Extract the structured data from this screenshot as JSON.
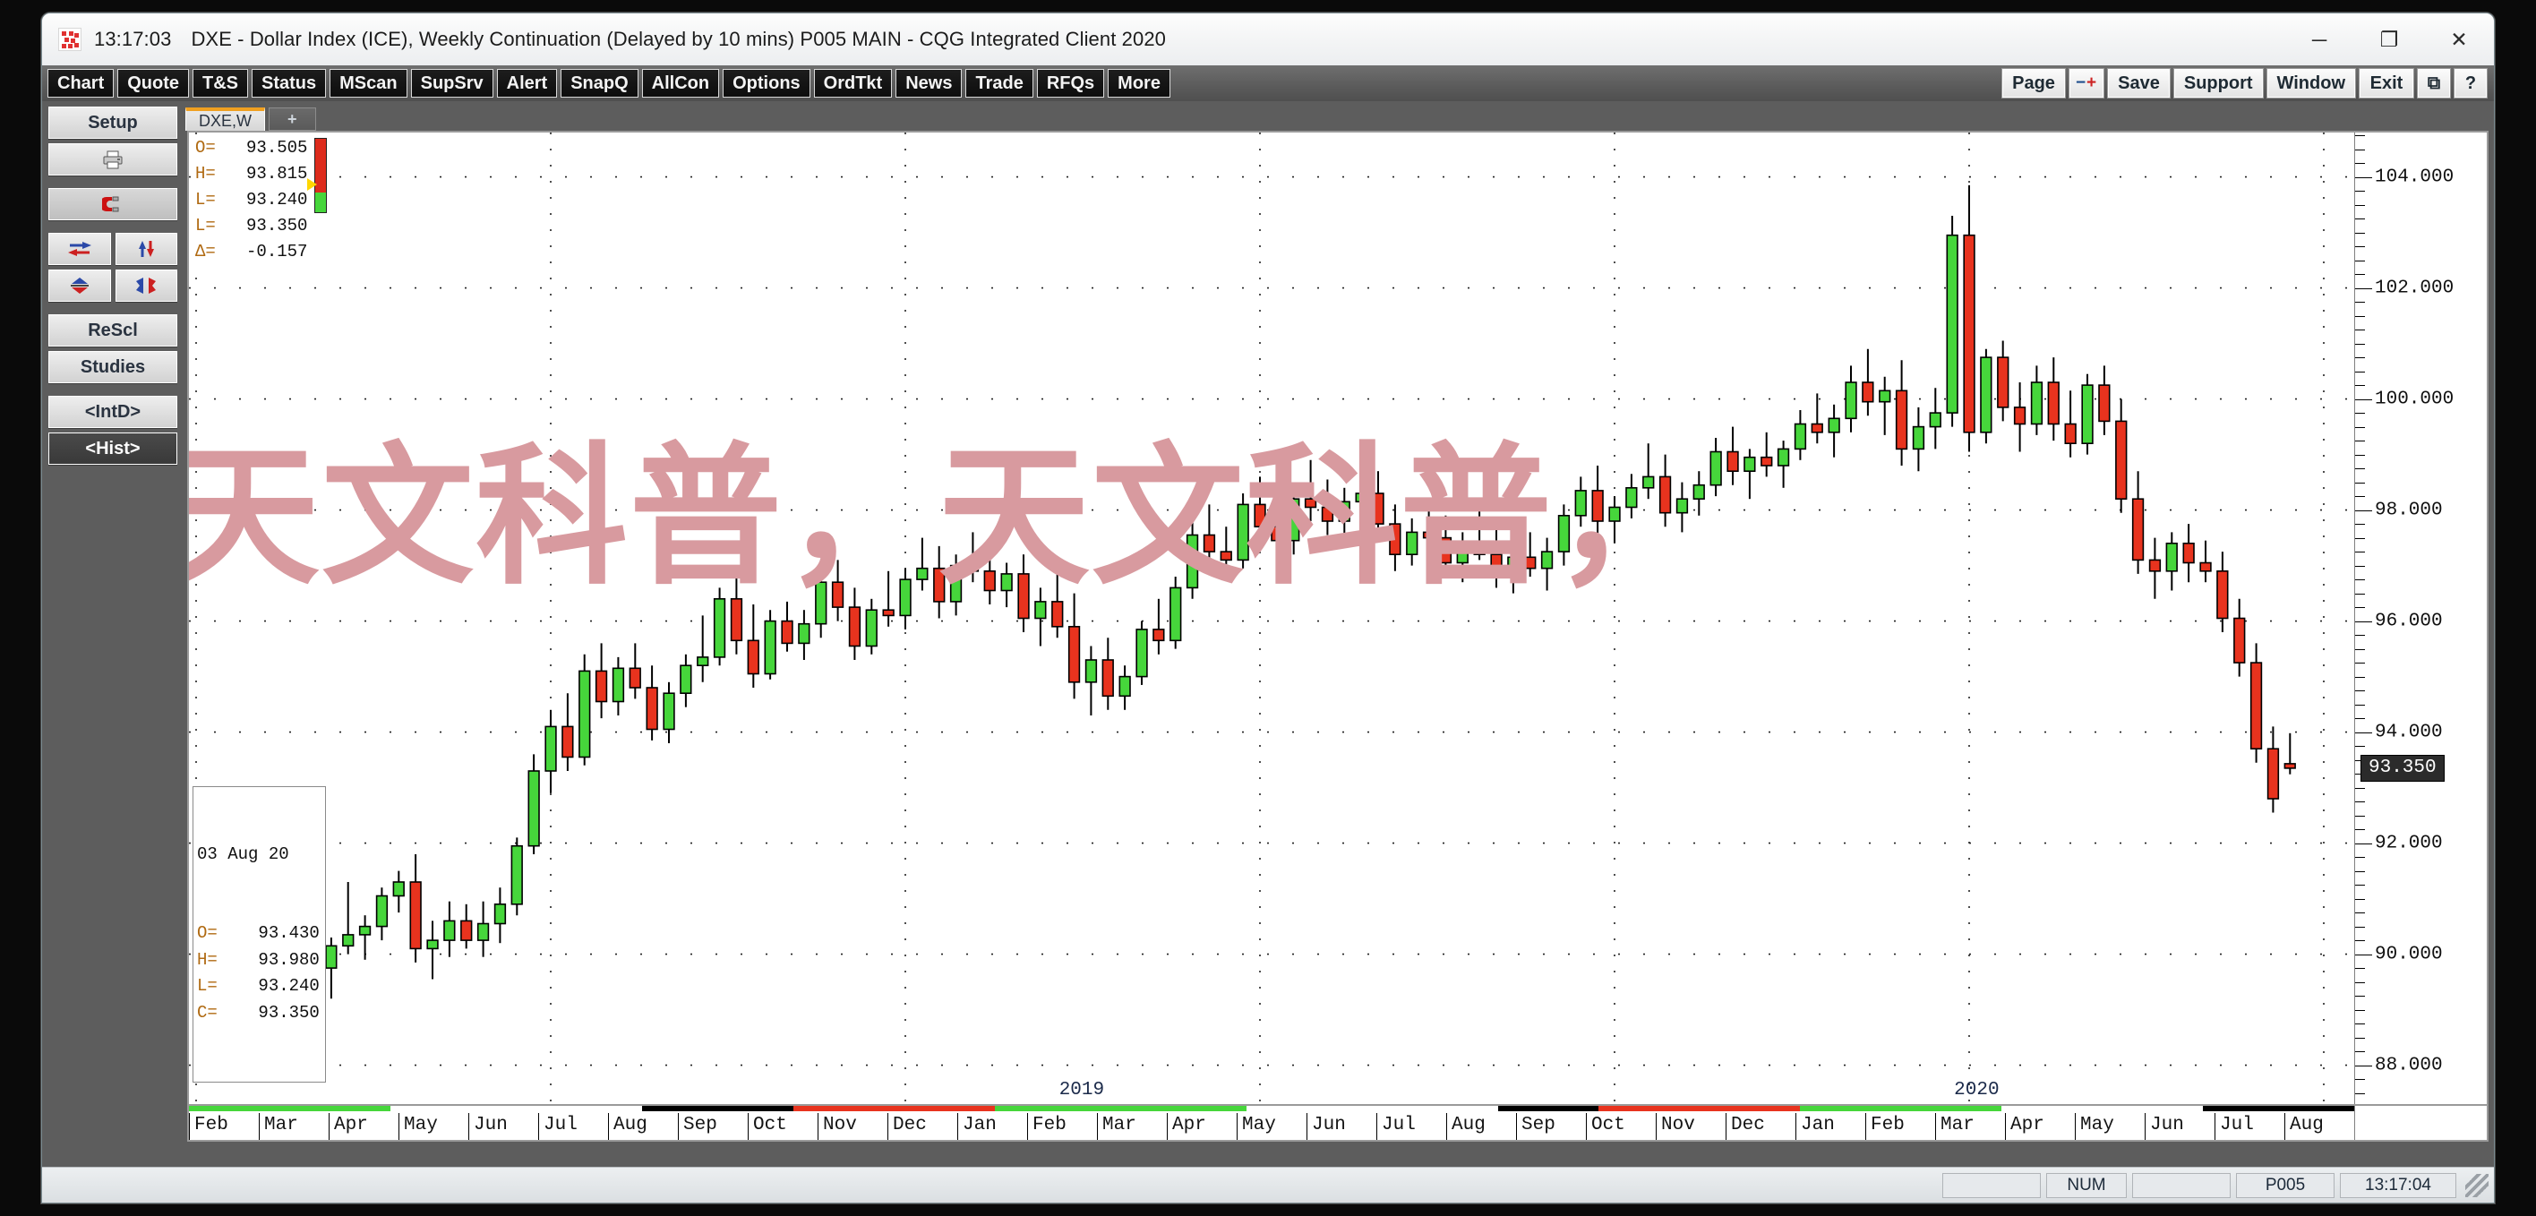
{
  "window": {
    "clock": "13:17:03",
    "title": "DXE - Dollar Index (ICE), Weekly Continuation (Delayed by 10 mins)   P005 MAIN - CQG Integrated Client 2020",
    "minimize": "─",
    "maximize": "❐",
    "close": "✕"
  },
  "toolbar": {
    "left": [
      {
        "label": "Chart"
      },
      {
        "label": "Quote"
      },
      {
        "label": "T&S"
      },
      {
        "label": "Status"
      },
      {
        "label": "MScan"
      },
      {
        "label": "SupSrv"
      },
      {
        "label": "Alert"
      },
      {
        "label": "SnapQ"
      },
      {
        "label": "AllCon"
      },
      {
        "label": "Options"
      },
      {
        "label": "OrdTkt"
      },
      {
        "label": "News"
      },
      {
        "label": "Trade"
      },
      {
        "label": "RFQs"
      },
      {
        "label": "More"
      }
    ],
    "right": [
      {
        "label": "Page"
      },
      {
        "label": "-+"
      },
      {
        "label": "Save"
      },
      {
        "label": "Support"
      },
      {
        "label": "Window"
      },
      {
        "label": "Exit"
      },
      {
        "label": "⧉"
      },
      {
        "label": "?"
      }
    ]
  },
  "sidebar": {
    "setup": "Setup",
    "print": "print-icon",
    "magnet": "magnet-icon",
    "arrow_left": "arrow-horizontal-icon",
    "arrow_updown": "arrow-vertical-icon",
    "arrow_collapse": "arrow-collapse-icon",
    "arrow_split": "arrow-split-icon",
    "rescl": "ReScl",
    "studies": "Studies",
    "intd": "<IntD>",
    "hist": "<Hist>"
  },
  "tabs": {
    "items": [
      {
        "label": "DXE,W",
        "active": true
      }
    ],
    "add": "+"
  },
  "quote": {
    "rows": [
      {
        "label": "O=",
        "value": "93.505"
      },
      {
        "label": "H=",
        "value": "93.815"
      },
      {
        "label": "L=",
        "value": "93.240"
      },
      {
        "label": "L=",
        "value": "93.350"
      },
      {
        "label": "Δ=",
        "value": "-0.157"
      }
    ]
  },
  "barinfo": {
    "date": "03 Aug 20",
    "rows": [
      {
        "label": "O=",
        "value": "93.430"
      },
      {
        "label": "H=",
        "value": "93.980"
      },
      {
        "label": "L=",
        "value": "93.240"
      },
      {
        "label": "C=",
        "value": "93.350"
      }
    ]
  },
  "statusbar": {
    "panel1": "",
    "num": "NUM",
    "panel2": "",
    "page": "P005",
    "time": "13:17:04"
  },
  "colors": {
    "up": "#46d63b",
    "down": "#e8331e",
    "wick": "#000000",
    "grid": "#222222",
    "watermark": "#d89a9f",
    "accent": "#f0a020"
  },
  "watermark_text": "天文科普，天文科普，",
  "chart_data": {
    "type": "candlestick",
    "title": "DXE - Dollar Index (ICE), Weekly Continuation",
    "xlabel": "",
    "ylabel": "",
    "ylim": [
      87.3,
      104.8
    ],
    "yticks": [
      104.0,
      102.0,
      100.0,
      98.0,
      96.0,
      94.0,
      92.0,
      90.0,
      88.0
    ],
    "ytick_labels": [
      "104.000",
      "102.000",
      "100.000",
      "98.000",
      "96.000",
      "94.000",
      "92.000",
      "90.000",
      "88.000"
    ],
    "current_price": "93.350",
    "grid": "dotted",
    "year_markers": [
      {
        "label": "2019",
        "index": 50
      },
      {
        "label": "2020",
        "index": 103
      }
    ],
    "month_labels": [
      "Feb",
      "Mar",
      "Apr",
      "May",
      "Jun",
      "Jul",
      "Aug",
      "Sep",
      "Oct",
      "Nov",
      "Dec",
      "Jan",
      "Feb",
      "Mar",
      "Apr",
      "May",
      "Jun",
      "Jul",
      "Aug",
      "Sep",
      "Oct",
      "Nov",
      "Dec",
      "Jan",
      "Feb",
      "Mar",
      "Apr",
      "May",
      "Jun",
      "Jul",
      "Aug"
    ],
    "month_strip": [
      {
        "color": "#46d63b",
        "span": 4
      },
      {
        "color": "#ffffff",
        "span": 5
      },
      {
        "color": "#000000",
        "span": 3
      },
      {
        "color": "#e8331e",
        "span": 4
      },
      {
        "color": "#46d63b",
        "span": 5
      },
      {
        "color": "#ffffff",
        "span": 5
      },
      {
        "color": "#000000",
        "span": 2
      },
      {
        "color": "#e8331e",
        "span": 4
      },
      {
        "color": "#46d63b",
        "span": 4
      },
      {
        "color": "#ffffff",
        "span": 4
      },
      {
        "color": "#000000",
        "span": 3
      }
    ],
    "candles": [
      {
        "o": 90.3,
        "h": 90.55,
        "l": 90.05,
        "c": 90.12
      },
      {
        "o": 90.12,
        "h": 90.3,
        "l": 89.7,
        "c": 89.82
      },
      {
        "o": 89.82,
        "h": 90.1,
        "l": 89.55,
        "c": 90.05
      },
      {
        "o": 90.05,
        "h": 90.45,
        "l": 89.85,
        "c": 89.95
      },
      {
        "o": 89.95,
        "h": 90.6,
        "l": 89.6,
        "c": 90.35
      },
      {
        "o": 90.35,
        "h": 90.8,
        "l": 89.95,
        "c": 90.1
      },
      {
        "o": 90.1,
        "h": 90.4,
        "l": 89.4,
        "c": 89.75
      },
      {
        "o": 89.75,
        "h": 90.3,
        "l": 89.2,
        "c": 90.15
      },
      {
        "o": 90.15,
        "h": 91.3,
        "l": 90.0,
        "c": 90.35
      },
      {
        "o": 90.35,
        "h": 90.7,
        "l": 89.9,
        "c": 90.5
      },
      {
        "o": 90.5,
        "h": 91.2,
        "l": 90.25,
        "c": 91.05
      },
      {
        "o": 91.05,
        "h": 91.5,
        "l": 90.75,
        "c": 91.3
      },
      {
        "o": 91.3,
        "h": 91.8,
        "l": 89.85,
        "c": 90.1
      },
      {
        "o": 90.1,
        "h": 90.6,
        "l": 89.55,
        "c": 90.25
      },
      {
        "o": 90.25,
        "h": 90.95,
        "l": 89.95,
        "c": 90.6
      },
      {
        "o": 90.6,
        "h": 90.9,
        "l": 90.1,
        "c": 90.25
      },
      {
        "o": 90.25,
        "h": 90.95,
        "l": 89.95,
        "c": 90.55
      },
      {
        "o": 90.55,
        "h": 91.2,
        "l": 90.2,
        "c": 90.9
      },
      {
        "o": 90.9,
        "h": 92.1,
        "l": 90.7,
        "c": 91.95
      },
      {
        "o": 91.95,
        "h": 93.6,
        "l": 91.8,
        "c": 93.3
      },
      {
        "o": 93.3,
        "h": 94.4,
        "l": 92.9,
        "c": 94.1
      },
      {
        "o": 94.1,
        "h": 94.7,
        "l": 93.3,
        "c": 93.55
      },
      {
        "o": 93.55,
        "h": 95.4,
        "l": 93.4,
        "c": 95.1
      },
      {
        "o": 95.1,
        "h": 95.6,
        "l": 94.25,
        "c": 94.55
      },
      {
        "o": 94.55,
        "h": 95.35,
        "l": 94.3,
        "c": 95.15
      },
      {
        "o": 95.15,
        "h": 95.6,
        "l": 94.6,
        "c": 94.8
      },
      {
        "o": 94.8,
        "h": 95.2,
        "l": 93.85,
        "c": 94.05
      },
      {
        "o": 94.05,
        "h": 94.9,
        "l": 93.8,
        "c": 94.7
      },
      {
        "o": 94.7,
        "h": 95.4,
        "l": 94.45,
        "c": 95.2
      },
      {
        "o": 95.2,
        "h": 96.1,
        "l": 94.9,
        "c": 95.35
      },
      {
        "o": 95.35,
        "h": 96.6,
        "l": 95.2,
        "c": 96.4
      },
      {
        "o": 96.4,
        "h": 96.9,
        "l": 95.4,
        "c": 95.65
      },
      {
        "o": 95.65,
        "h": 96.3,
        "l": 94.8,
        "c": 95.05
      },
      {
        "o": 95.05,
        "h": 96.2,
        "l": 94.95,
        "c": 96.0
      },
      {
        "o": 96.0,
        "h": 96.35,
        "l": 95.45,
        "c": 95.6
      },
      {
        "o": 95.6,
        "h": 96.2,
        "l": 95.3,
        "c": 95.95
      },
      {
        "o": 95.95,
        "h": 96.9,
        "l": 95.7,
        "c": 96.7
      },
      {
        "o": 96.7,
        "h": 97.1,
        "l": 96.0,
        "c": 96.25
      },
      {
        "o": 96.25,
        "h": 96.6,
        "l": 95.3,
        "c": 95.55
      },
      {
        "o": 95.55,
        "h": 96.4,
        "l": 95.4,
        "c": 96.2
      },
      {
        "o": 96.2,
        "h": 96.9,
        "l": 95.9,
        "c": 96.1
      },
      {
        "o": 96.1,
        "h": 96.95,
        "l": 95.85,
        "c": 96.75
      },
      {
        "o": 96.75,
        "h": 97.5,
        "l": 96.55,
        "c": 96.95
      },
      {
        "o": 96.95,
        "h": 97.35,
        "l": 96.05,
        "c": 96.35
      },
      {
        "o": 96.35,
        "h": 97.2,
        "l": 96.1,
        "c": 97.0
      },
      {
        "o": 97.0,
        "h": 97.6,
        "l": 96.7,
        "c": 96.9
      },
      {
        "o": 96.9,
        "h": 97.3,
        "l": 96.3,
        "c": 96.55
      },
      {
        "o": 96.55,
        "h": 97.05,
        "l": 96.25,
        "c": 96.85
      },
      {
        "o": 96.85,
        "h": 97.2,
        "l": 95.8,
        "c": 96.05
      },
      {
        "o": 96.05,
        "h": 96.6,
        "l": 95.55,
        "c": 96.35
      },
      {
        "o": 96.35,
        "h": 97.0,
        "l": 95.7,
        "c": 95.9
      },
      {
        "o": 95.9,
        "h": 96.5,
        "l": 94.6,
        "c": 94.9
      },
      {
        "o": 94.9,
        "h": 95.55,
        "l": 94.3,
        "c": 95.3
      },
      {
        "o": 95.3,
        "h": 95.7,
        "l": 94.4,
        "c": 94.65
      },
      {
        "o": 94.65,
        "h": 95.2,
        "l": 94.4,
        "c": 95.0
      },
      {
        "o": 95.0,
        "h": 96.0,
        "l": 94.85,
        "c": 95.85
      },
      {
        "o": 95.85,
        "h": 96.4,
        "l": 95.4,
        "c": 95.65
      },
      {
        "o": 95.65,
        "h": 96.8,
        "l": 95.5,
        "c": 96.6
      },
      {
        "o": 96.6,
        "h": 97.8,
        "l": 96.4,
        "c": 97.55
      },
      {
        "o": 97.55,
        "h": 98.1,
        "l": 96.95,
        "c": 97.25
      },
      {
        "o": 97.25,
        "h": 97.7,
        "l": 96.9,
        "c": 97.1
      },
      {
        "o": 97.1,
        "h": 98.3,
        "l": 96.95,
        "c": 98.1
      },
      {
        "o": 98.1,
        "h": 98.6,
        "l": 97.45,
        "c": 97.7
      },
      {
        "o": 97.7,
        "h": 98.2,
        "l": 97.3,
        "c": 97.45
      },
      {
        "o": 97.45,
        "h": 98.4,
        "l": 97.2,
        "c": 98.2
      },
      {
        "o": 98.2,
        "h": 98.9,
        "l": 97.8,
        "c": 98.05
      },
      {
        "o": 98.05,
        "h": 98.55,
        "l": 97.55,
        "c": 97.8
      },
      {
        "o": 97.8,
        "h": 98.4,
        "l": 97.4,
        "c": 98.15
      },
      {
        "o": 98.15,
        "h": 98.75,
        "l": 97.9,
        "c": 98.3
      },
      {
        "o": 98.3,
        "h": 98.7,
        "l": 97.5,
        "c": 97.75
      },
      {
        "o": 97.75,
        "h": 98.1,
        "l": 96.9,
        "c": 97.2
      },
      {
        "o": 97.2,
        "h": 97.85,
        "l": 97.0,
        "c": 97.6
      },
      {
        "o": 97.6,
        "h": 98.2,
        "l": 97.3,
        "c": 97.5
      },
      {
        "o": 97.5,
        "h": 97.9,
        "l": 96.8,
        "c": 97.05
      },
      {
        "o": 97.05,
        "h": 97.6,
        "l": 96.7,
        "c": 97.35
      },
      {
        "o": 97.35,
        "h": 98.0,
        "l": 97.1,
        "c": 97.2
      },
      {
        "o": 97.2,
        "h": 97.75,
        "l": 96.6,
        "c": 96.85
      },
      {
        "o": 96.85,
        "h": 97.4,
        "l": 96.5,
        "c": 97.15
      },
      {
        "o": 97.15,
        "h": 97.6,
        "l": 96.8,
        "c": 96.95
      },
      {
        "o": 96.95,
        "h": 97.5,
        "l": 96.55,
        "c": 97.25
      },
      {
        "o": 97.25,
        "h": 98.1,
        "l": 97.0,
        "c": 97.9
      },
      {
        "o": 97.9,
        "h": 98.6,
        "l": 97.7,
        "c": 98.35
      },
      {
        "o": 98.35,
        "h": 98.8,
        "l": 97.55,
        "c": 97.8
      },
      {
        "o": 97.8,
        "h": 98.25,
        "l": 97.4,
        "c": 98.05
      },
      {
        "o": 98.05,
        "h": 98.65,
        "l": 97.85,
        "c": 98.4
      },
      {
        "o": 98.4,
        "h": 99.2,
        "l": 98.2,
        "c": 98.6
      },
      {
        "o": 98.6,
        "h": 99.0,
        "l": 97.7,
        "c": 97.95
      },
      {
        "o": 97.95,
        "h": 98.5,
        "l": 97.6,
        "c": 98.2
      },
      {
        "o": 98.2,
        "h": 98.7,
        "l": 97.9,
        "c": 98.45
      },
      {
        "o": 98.45,
        "h": 99.3,
        "l": 98.25,
        "c": 99.05
      },
      {
        "o": 99.05,
        "h": 99.5,
        "l": 98.45,
        "c": 98.7
      },
      {
        "o": 98.7,
        "h": 99.1,
        "l": 98.2,
        "c": 98.95
      },
      {
        "o": 98.95,
        "h": 99.4,
        "l": 98.6,
        "c": 98.8
      },
      {
        "o": 98.8,
        "h": 99.25,
        "l": 98.4,
        "c": 99.1
      },
      {
        "o": 99.1,
        "h": 99.8,
        "l": 98.9,
        "c": 99.55
      },
      {
        "o": 99.55,
        "h": 100.1,
        "l": 99.2,
        "c": 99.4
      },
      {
        "o": 99.4,
        "h": 99.9,
        "l": 98.95,
        "c": 99.65
      },
      {
        "o": 99.65,
        "h": 100.6,
        "l": 99.4,
        "c": 100.3
      },
      {
        "o": 100.3,
        "h": 100.9,
        "l": 99.7,
        "c": 99.95
      },
      {
        "o": 99.95,
        "h": 100.4,
        "l": 99.35,
        "c": 100.15
      },
      {
        "o": 100.15,
        "h": 100.7,
        "l": 98.8,
        "c": 99.1
      },
      {
        "o": 99.1,
        "h": 99.85,
        "l": 98.7,
        "c": 99.5
      },
      {
        "o": 99.5,
        "h": 100.2,
        "l": 99.1,
        "c": 99.75
      },
      {
        "o": 99.75,
        "h": 103.3,
        "l": 99.5,
        "c": 102.95
      },
      {
        "o": 102.95,
        "h": 103.85,
        "l": 99.05,
        "c": 99.4
      },
      {
        "o": 99.4,
        "h": 100.9,
        "l": 99.2,
        "c": 100.75
      },
      {
        "o": 100.75,
        "h": 101.05,
        "l": 99.6,
        "c": 99.85
      },
      {
        "o": 99.85,
        "h": 100.3,
        "l": 99.05,
        "c": 99.55
      },
      {
        "o": 99.55,
        "h": 100.6,
        "l": 99.35,
        "c": 100.3
      },
      {
        "o": 100.3,
        "h": 100.75,
        "l": 99.25,
        "c": 99.55
      },
      {
        "o": 99.55,
        "h": 100.15,
        "l": 98.95,
        "c": 99.2
      },
      {
        "o": 99.2,
        "h": 100.45,
        "l": 99.0,
        "c": 100.25
      },
      {
        "o": 100.25,
        "h": 100.6,
        "l": 99.35,
        "c": 99.6
      },
      {
        "o": 99.6,
        "h": 100.0,
        "l": 97.95,
        "c": 98.2
      },
      {
        "o": 98.2,
        "h": 98.7,
        "l": 96.85,
        "c": 97.1
      },
      {
        "o": 97.1,
        "h": 97.5,
        "l": 96.4,
        "c": 96.9
      },
      {
        "o": 96.9,
        "h": 97.6,
        "l": 96.55,
        "c": 97.4
      },
      {
        "o": 97.4,
        "h": 97.75,
        "l": 96.7,
        "c": 97.05
      },
      {
        "o": 97.05,
        "h": 97.45,
        "l": 96.7,
        "c": 96.9
      },
      {
        "o": 96.9,
        "h": 97.25,
        "l": 95.8,
        "c": 96.05
      },
      {
        "o": 96.05,
        "h": 96.4,
        "l": 95.0,
        "c": 95.25
      },
      {
        "o": 95.25,
        "h": 95.6,
        "l": 93.45,
        "c": 93.7
      },
      {
        "o": 93.7,
        "h": 94.1,
        "l": 92.55,
        "c": 92.8
      },
      {
        "o": 93.43,
        "h": 93.98,
        "l": 93.24,
        "c": 93.35
      }
    ]
  }
}
